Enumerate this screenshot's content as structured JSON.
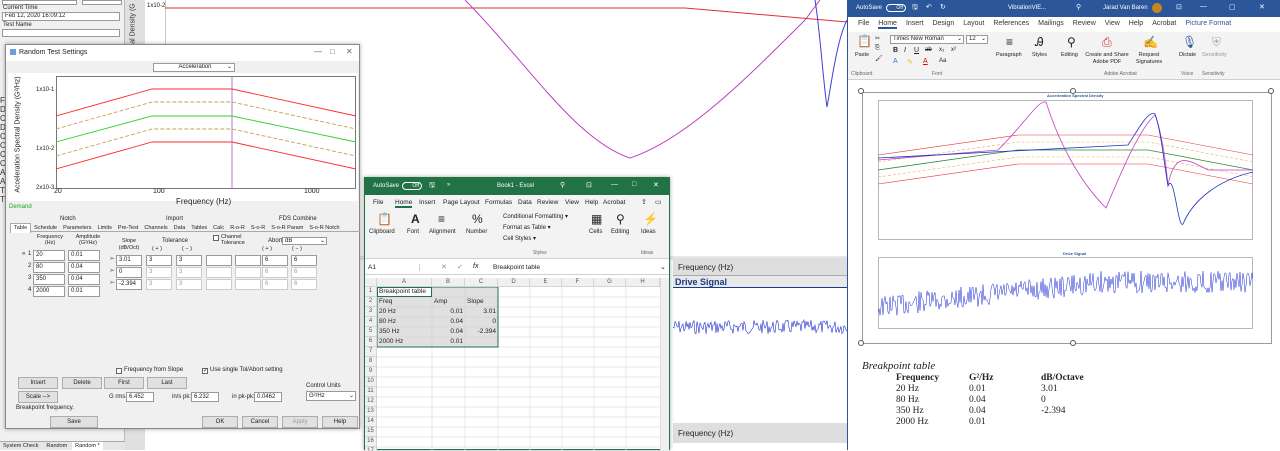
{
  "left_panel": {
    "current_time_label": "Current Time",
    "current_time_value": "Feb 12, 2020 16:09:12",
    "test_name_label": "Test Name",
    "bottom_tabs": [
      "System Check",
      "Random",
      "Random *"
    ]
  },
  "bg_plot": {
    "y_tick": "1x10-2",
    "y_label": "al Density (G",
    "x_label": "Frequency (Hz)",
    "drive_title": "Drive Signal",
    "x_label_bottom": "Frequency (Hz)"
  },
  "dialog": {
    "title": "Random Test Settings",
    "mode_select": "Acceleration",
    "chart": {
      "ylabel": "Acceleration Spectral Density (G²/Hz)",
      "xlabel": "Frequency (Hz)",
      "y_ticks": [
        "1x10-1",
        "1x10-2",
        "2x10-3"
      ],
      "x_ticks": [
        "20",
        "100",
        "1000"
      ]
    },
    "demand_label": "Demand",
    "group_labels": {
      "notch": "Notch",
      "import": "Import",
      "fds": "FDS Combine"
    },
    "tabs": [
      "Table",
      "Schedule",
      "Parameters",
      "Limits",
      "Pre-Test",
      "Channels",
      "Data",
      "Tables",
      "Calc",
      "R-o-R",
      "S-o-R",
      "S-o-R Param",
      "S-o-R Notch"
    ],
    "col_headers": {
      "freq": "Frequency (Hz)",
      "amp": "Amplitude (G²/Hz)",
      "slope": "Slope (dB/Oct)",
      "tol": "Tolerance",
      "plus": "( + )",
      "minus": "( − )",
      "channel_tol": "Channel Tolerance",
      "abort": "Abort",
      "abort_unit": "dB"
    },
    "rows": [
      {
        "num": "1",
        "freq": "20",
        "amp": "0.01",
        "slope": "3.01",
        "tp": "3",
        "tm": "3",
        "ap": "6",
        "am": "6"
      },
      {
        "num": "2",
        "freq": "80",
        "amp": "0.04",
        "slope": "0",
        "tp": "3",
        "tm": "3",
        "ap": "6",
        "am": "6"
      },
      {
        "num": "3",
        "freq": "350",
        "amp": "0.04",
        "slope": "-2.394",
        "tp": "3",
        "tm": "3",
        "ap": "6",
        "am": "6"
      },
      {
        "num": "4",
        "freq": "2000",
        "amp": "0.01",
        "slope": "",
        "tp": "",
        "tm": "",
        "ap": "",
        "am": ""
      }
    ],
    "freq_from_slope": "Frequency from Slope",
    "single_tol": "Use single Tol/Abort setting",
    "buttons": {
      "insert": "Insert",
      "delete": "Delete",
      "first": "First",
      "last": "Last",
      "scale": "Scale -->",
      "save": "Save",
      "ok": "OK",
      "cancel": "Cancel",
      "apply": "Apply",
      "help": "Help"
    },
    "grms_label": "G rms:",
    "grms": "6.452",
    "inpk_label": "in/s pk:",
    "inpk": "6.232",
    "inpkpk_label": "in pk-pk:",
    "inpkpk": "0.0462",
    "control_units_label": "Control Units",
    "control_units": "G²/Hz",
    "status": "Breakpoint frequency."
  },
  "excel": {
    "autosave": "AutoSave",
    "toggle": "Off",
    "title": "Book1 - Excel",
    "tabs": [
      "File",
      "Home",
      "Insert",
      "Page Layout",
      "Formulas",
      "Data",
      "Review",
      "View",
      "Help",
      "Acrobat"
    ],
    "ribbon": [
      "Clipboard",
      "Font",
      "Alignment",
      "Number",
      "Conditional Formatting ▾",
      "Format as Table ▾",
      "Cell Styles ▾",
      "Styles",
      "Cells",
      "Editing",
      "Ideas",
      "Ideas"
    ],
    "name_box": "A1",
    "formula": "Breakpoint table",
    "col_headers": [
      "A",
      "B",
      "C",
      "D",
      "E",
      "F",
      "G",
      "H"
    ],
    "row_numbers": [
      "1",
      "2",
      "3",
      "4",
      "5",
      "6",
      "7",
      "8",
      "9",
      "10",
      "11",
      "12",
      "13",
      "14",
      "15",
      "16",
      "17"
    ],
    "cells": [
      [
        "Breakpoint table",
        "",
        ""
      ],
      [
        "Freq",
        "Amp",
        "Slope"
      ],
      [
        "20 Hz",
        "0.01",
        "3.01"
      ],
      [
        "80 Hz",
        "0.04",
        "0"
      ],
      [
        "350 Hz",
        "0.04",
        "-2.394"
      ],
      [
        "2000 Hz",
        "0.01",
        ""
      ]
    ]
  },
  "word": {
    "autosave": "AutoSave",
    "toggle": "Off",
    "title": "VibrationVIE...",
    "user": "Jarad Van Baren",
    "tabs": [
      "File",
      "Home",
      "Insert",
      "Design",
      "Layout",
      "References",
      "Mailings",
      "Review",
      "View",
      "Help",
      "Acrobat",
      "Picture Format"
    ],
    "font_name": "Times New Roman",
    "font_size": "12",
    "ribbon": [
      "Paste",
      "Clipboard",
      "Font",
      "Paragraph",
      "Styles",
      "Editing",
      "Create and Share Adobe PDF",
      "Request Signatures",
      "Adobe Acrobat",
      "Dictate",
      "Voice",
      "Sensitivity",
      "Sensitivity"
    ],
    "chart1_title": "Acceleration Spectral Density",
    "chart2_title": "Drive Signal",
    "table_title": "Breakpoint table",
    "table_headers": [
      "Frequency",
      "G²/Hz",
      "dB/Octave"
    ],
    "table_rows": [
      [
        "20 Hz",
        "0.01",
        "3.01"
      ],
      [
        "80 Hz",
        "0.04",
        "0"
      ],
      [
        "350 Hz",
        "0.04",
        "-2.394"
      ],
      [
        "2000 Hz",
        "0.01",
        ""
      ]
    ]
  }
}
